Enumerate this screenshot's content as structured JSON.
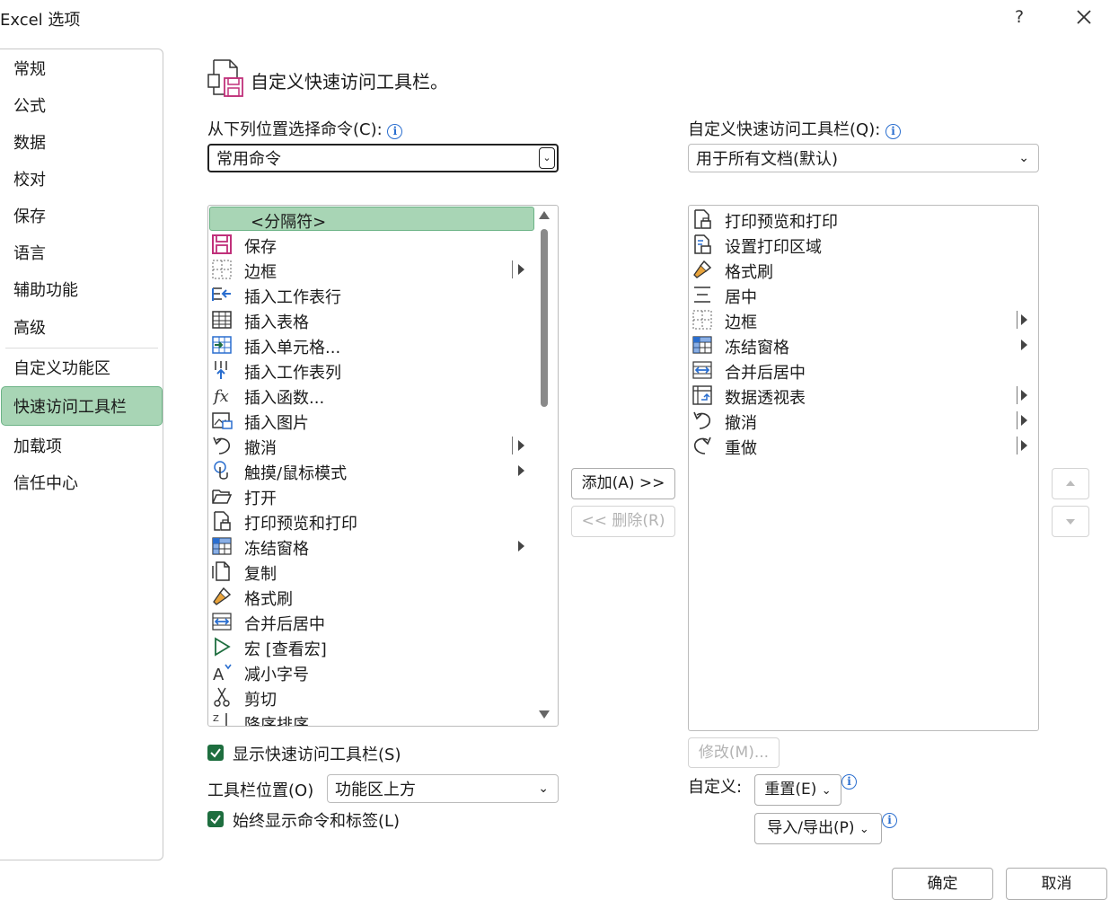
{
  "window": {
    "title": "Excel 选项",
    "help": "?",
    "close_icon": "close-icon"
  },
  "sidebar": {
    "items": [
      {
        "label": "常规"
      },
      {
        "label": "公式"
      },
      {
        "label": "数据"
      },
      {
        "label": "校对"
      },
      {
        "label": "保存"
      },
      {
        "label": "语言"
      },
      {
        "label": "辅助功能"
      },
      {
        "label": "高级"
      },
      {
        "label": "自定义功能区"
      },
      {
        "label": "快速访问工具栏"
      },
      {
        "label": "加载项"
      },
      {
        "label": "信任中心"
      }
    ],
    "selected": "快速访问工具栏"
  },
  "header": {
    "title": "自定义快速访问工具栏。"
  },
  "left": {
    "label": "从下列位置选择命令(C):",
    "dropdown_value": "常用命令",
    "items": [
      {
        "label": "<分隔符>",
        "icon": "none",
        "arrow": false,
        "bar": false
      },
      {
        "label": "保存",
        "icon": "save-icon",
        "arrow": false,
        "bar": false
      },
      {
        "label": "边框",
        "icon": "border-icon",
        "arrow": true,
        "bar": true
      },
      {
        "label": "插入工作表行",
        "icon": "insert-row-icon",
        "arrow": false,
        "bar": false
      },
      {
        "label": "插入表格",
        "icon": "table-icon",
        "arrow": false,
        "bar": false
      },
      {
        "label": "插入单元格...",
        "icon": "insert-cells-icon",
        "arrow": false,
        "bar": false
      },
      {
        "label": "插入工作表列",
        "icon": "insert-column-icon",
        "arrow": false,
        "bar": false
      },
      {
        "label": "插入函数...",
        "icon": "function-icon",
        "arrow": false,
        "bar": false
      },
      {
        "label": "插入图片",
        "icon": "picture-icon",
        "arrow": false,
        "bar": false
      },
      {
        "label": "撤消",
        "icon": "undo-icon",
        "arrow": true,
        "bar": true
      },
      {
        "label": "触摸/鼠标模式",
        "icon": "touch-icon",
        "arrow": true,
        "bar": false
      },
      {
        "label": "打开",
        "icon": "open-folder-icon",
        "arrow": false,
        "bar": false
      },
      {
        "label": "打印预览和打印",
        "icon": "print-preview-icon",
        "arrow": false,
        "bar": false
      },
      {
        "label": "冻结窗格",
        "icon": "freeze-panes-icon",
        "arrow": true,
        "bar": false
      },
      {
        "label": "复制",
        "icon": "copy-icon",
        "arrow": false,
        "bar": false
      },
      {
        "label": "格式刷",
        "icon": "format-painter-icon",
        "arrow": false,
        "bar": false
      },
      {
        "label": "合并后居中",
        "icon": "merge-center-icon",
        "arrow": false,
        "bar": false
      },
      {
        "label": "宏 [查看宏]",
        "icon": "macro-play-icon",
        "arrow": false,
        "bar": false
      },
      {
        "label": "减小字号",
        "icon": "decrease-font-icon",
        "arrow": false,
        "bar": false
      },
      {
        "label": "剪切",
        "icon": "scissors-icon",
        "arrow": false,
        "bar": false
      },
      {
        "label": "降序排序",
        "icon": "sort-desc-icon",
        "arrow": false,
        "bar": false
      }
    ]
  },
  "buttons": {
    "add": "添加(A) >>",
    "remove": "<< 删除(R)",
    "modify": "修改(M)..."
  },
  "right": {
    "label": "自定义快速访问工具栏(Q):",
    "dropdown_value": "用于所有文档(默认)",
    "items": [
      {
        "label": "打印预览和打印",
        "icon": "print-preview-icon",
        "arrow": false,
        "bar": false
      },
      {
        "label": "设置打印区域",
        "icon": "print-area-icon",
        "arrow": false,
        "bar": false
      },
      {
        "label": "格式刷",
        "icon": "format-painter-icon",
        "arrow": false,
        "bar": false
      },
      {
        "label": "居中",
        "icon": "align-center-icon",
        "arrow": false,
        "bar": false
      },
      {
        "label": "边框",
        "icon": "border-icon",
        "arrow": true,
        "bar": true
      },
      {
        "label": "冻结窗格",
        "icon": "freeze-panes-icon",
        "arrow": true,
        "bar": false
      },
      {
        "label": "合并后居中",
        "icon": "merge-center-icon",
        "arrow": false,
        "bar": false
      },
      {
        "label": "数据透视表",
        "icon": "pivot-table-icon",
        "arrow": true,
        "bar": true
      },
      {
        "label": "撤消",
        "icon": "undo-icon",
        "arrow": true,
        "bar": true
      },
      {
        "label": "重做",
        "icon": "redo-icon",
        "arrow": true,
        "bar": true
      }
    ]
  },
  "options": {
    "show_qat": "显示快速访问工具栏(S)",
    "position_label": "工具栏位置(O)",
    "position_value": "功能区上方",
    "always_show_labels": "始终显示命令和标签(L)",
    "customize_label": "自定义:",
    "reset": "重置(E)",
    "import_export": "导入/导出(P)"
  },
  "footer": {
    "ok": "确定",
    "cancel": "取消"
  },
  "colors": {
    "accent_green": "#1e6e3f",
    "selection": "#a8d5b5",
    "info_blue": "#2a6ecf"
  }
}
